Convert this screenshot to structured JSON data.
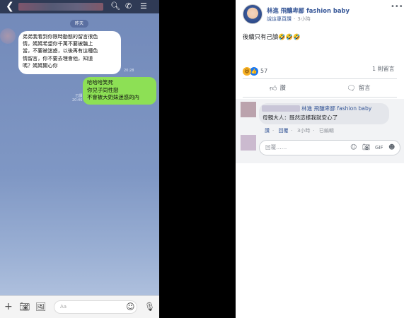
{
  "line_chat": {
    "date_label": "昨天",
    "incoming_message": "弟弟我看到你限時動態的留言很色\n情，媽媽希望你千萬不要被騙上\n當，不要被迷惑，以後再有這種色\n情留言，你不要去理會他，知道\n嗎？媽媽關心你",
    "incoming_time": "20:28",
    "outgoing_message": "哈哈哈笑死\n你兒子同性戀\n不會被大奶妹迷惑的內",
    "read_label": "已讀",
    "outgoing_time": "20:46",
    "input_placeholder": "Aa",
    "icons": [
      "back-icon",
      "search-icon",
      "phone-icon",
      "menu-icon",
      "plus-icon",
      "camera-icon",
      "image-icon",
      "emoji-icon",
      "mic-icon"
    ]
  },
  "facebook_post": {
    "author": "林進 飛釀卑鄙 fashion baby",
    "meta_link": "說這專頁讚",
    "meta_time": "3小時",
    "body": "後續只有己讀🤣🤣🤣",
    "reaction_count": "57",
    "comments_count": "1 則留言",
    "like_label": "讚",
    "comment_label": "留言",
    "comment": {
      "author": "林進 飛釀卑鄙 fashion baby",
      "text": "母親大人：既然這樣我就安心了",
      "like": "讚",
      "reply": "回覆",
      "time": "3小時",
      "edited": "已編輯"
    },
    "reply_placeholder": "回覆……",
    "colors": {
      "link": "#385898",
      "muted": "#90949c",
      "like_blue": "#1877f2"
    }
  }
}
